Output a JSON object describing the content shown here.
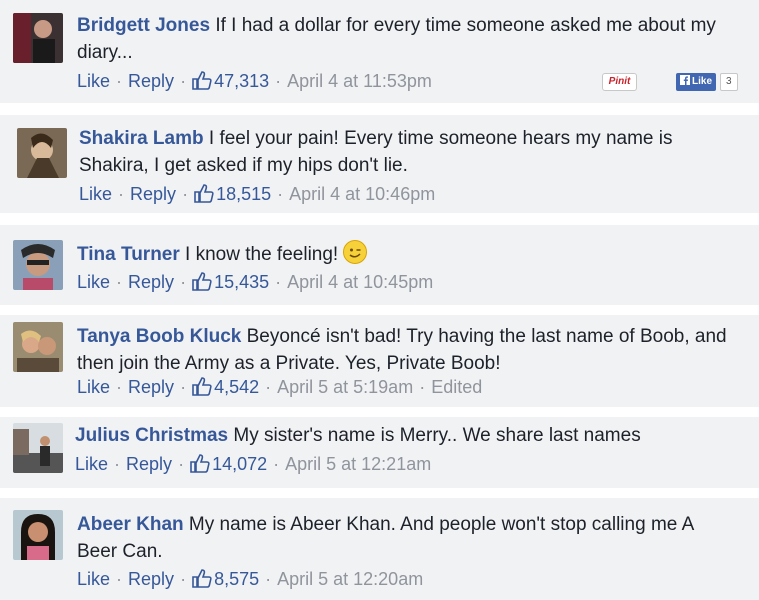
{
  "comments": [
    {
      "name": "Bridgett Jones",
      "text": "If I had a dollar for every time someone asked me about my diary...",
      "like": "Like",
      "reply": "Reply",
      "count": "47,313",
      "time": "April 4 at 11:53pm",
      "edited": ""
    },
    {
      "name": "Shakira Lamb",
      "text": "I feel your pain! Every time someone hears my name is Shakira, I get asked if my hips don't lie.",
      "like": "Like",
      "reply": "Reply",
      "count": "18,515",
      "time": "April 4 at 10:46pm",
      "edited": ""
    },
    {
      "name": "Tina Turner",
      "text": "I know the feeling!",
      "like": "Like",
      "reply": "Reply",
      "count": "15,435",
      "time": "April 4 at 10:45pm",
      "edited": ""
    },
    {
      "name": "Tanya Boob Kluck",
      "text": "Beyoncé isn't bad! Try having the last name of Boob, and then join the Army as a Private. Yes, Private Boob!",
      "like": "Like",
      "reply": "Reply",
      "count": "4,542",
      "time": "April 5 at 5:19am",
      "edited": "Edited"
    },
    {
      "name": "Julius Christmas",
      "text": "My sister's name is Merry.. We share last names",
      "like": "Like",
      "reply": "Reply",
      "count": "14,072",
      "time": "April 5 at 12:21am",
      "edited": ""
    },
    {
      "name": "Abeer Khan",
      "text": "My name is Abeer Khan. And people won't stop calling me A Beer Can.",
      "like": "Like",
      "reply": "Reply",
      "count": "8,575",
      "time": "April 5 at 12:20am",
      "edited": ""
    }
  ],
  "share": {
    "pinit": "Pinit",
    "fb_like": "Like",
    "fb_count": "3"
  },
  "colors": {
    "link": "#365899",
    "meta": "#90949c",
    "card_bg": "#f1f2f4"
  }
}
